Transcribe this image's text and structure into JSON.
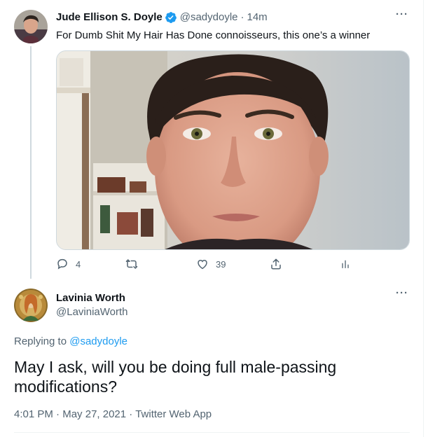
{
  "tweet": {
    "author_name": "Jude Ellison S. Doyle",
    "handle": "@sadydoyle",
    "separator": "·",
    "time_ago": "14m",
    "text": "For Dumb Shit My Hair Has Done connoisseurs, this one’s a winner",
    "more_label": "···",
    "actions": {
      "reply_count": "4",
      "like_count": "39"
    }
  },
  "reply": {
    "author_name": "Lavinia Worth",
    "handle": "@LaviniaWorth",
    "more_label": "···",
    "replying_prefix": "Replying to",
    "replying_to": "@sadydoyle",
    "text": "May I ask, will you be doing full male-passing modifications?",
    "time": "4:01 PM",
    "date": "May 27, 2021",
    "source": "Twitter Web App",
    "separator": "·"
  },
  "colors": {
    "accent": "#1d9bf0",
    "text_primary": "#0f1419",
    "text_secondary": "#536471",
    "border": "#cfd9de"
  },
  "icons": [
    "verified-badge-icon",
    "more-icon",
    "reply-icon",
    "retweet-icon",
    "like-icon",
    "share-icon",
    "analytics-icon"
  ]
}
